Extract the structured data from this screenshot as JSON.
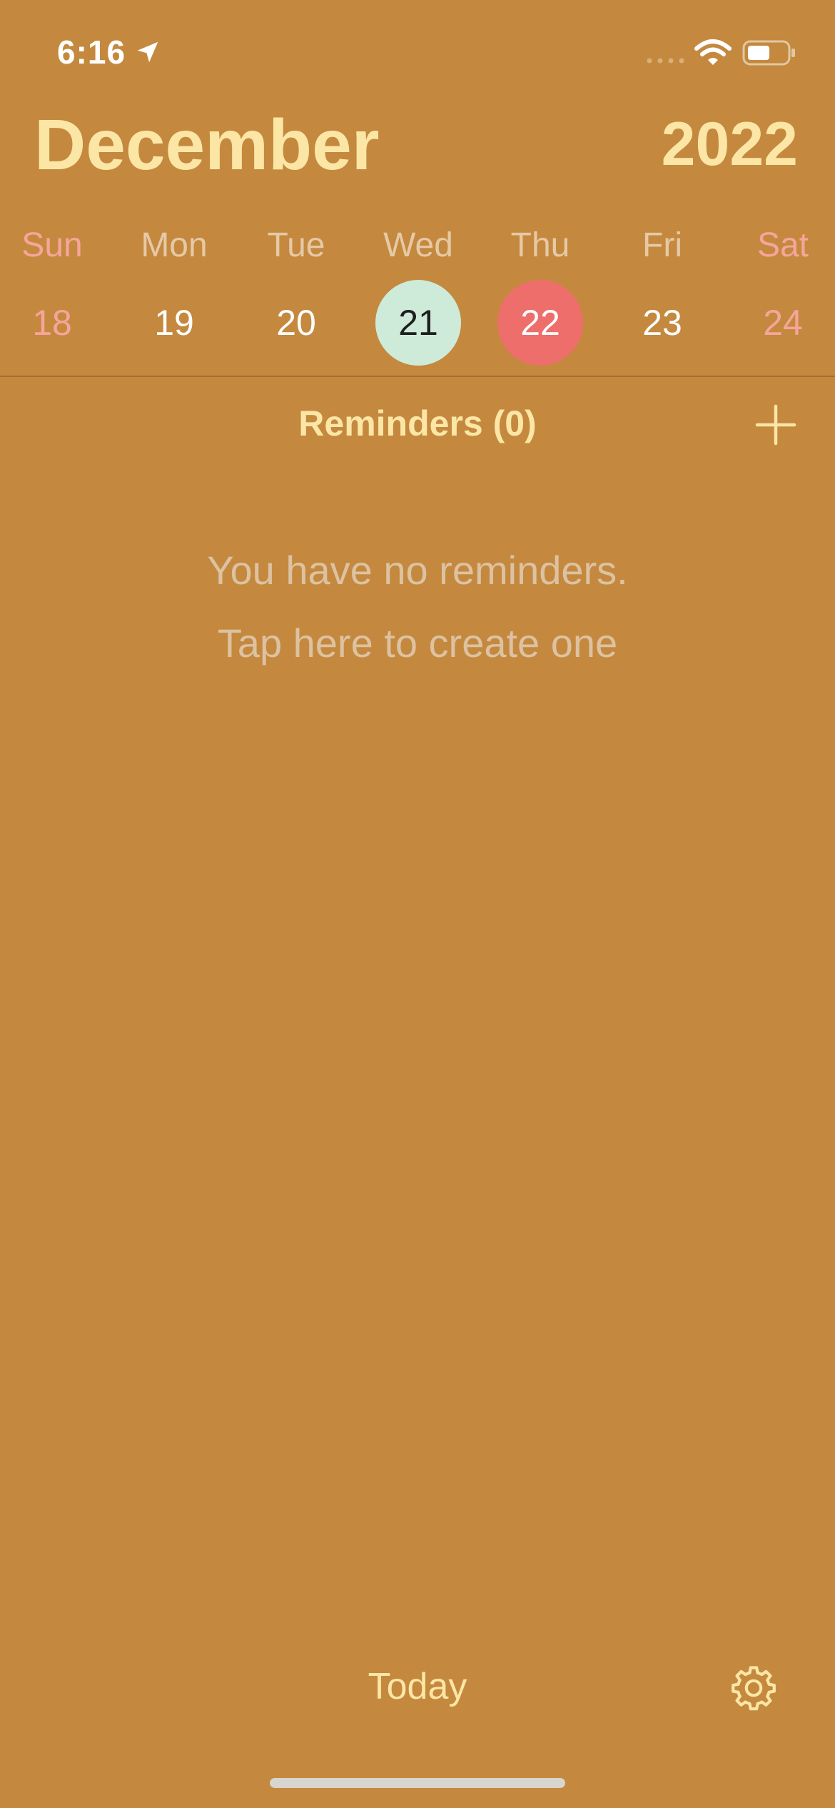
{
  "status_bar": {
    "time": "6:16",
    "icons": [
      "location-arrow-icon",
      "cellular-signal-icon",
      "wifi-icon",
      "battery-icon"
    ]
  },
  "header": {
    "month": "December",
    "year": "2022"
  },
  "week": {
    "days": [
      {
        "name": "Sun",
        "number": "18"
      },
      {
        "name": "Mon",
        "number": "19"
      },
      {
        "name": "Tue",
        "number": "20"
      },
      {
        "name": "Wed",
        "number": "21"
      },
      {
        "name": "Thu",
        "number": "22"
      },
      {
        "name": "Fri",
        "number": "23"
      },
      {
        "name": "Sat",
        "number": "24"
      }
    ]
  },
  "reminders": {
    "title": "Reminders (0)",
    "add_icon": "plus-icon",
    "empty_line_1": "You have no reminders.",
    "empty_line_2": "Tap here to create one"
  },
  "footer": {
    "today_label": "Today",
    "settings_icon": "gear-icon"
  },
  "colors": {
    "background": "#C4893E",
    "title": "#FBE6A6",
    "weekend": "#F6A59C",
    "selected_day": "#CDEBD8",
    "today_day": "#EE6E6B"
  }
}
